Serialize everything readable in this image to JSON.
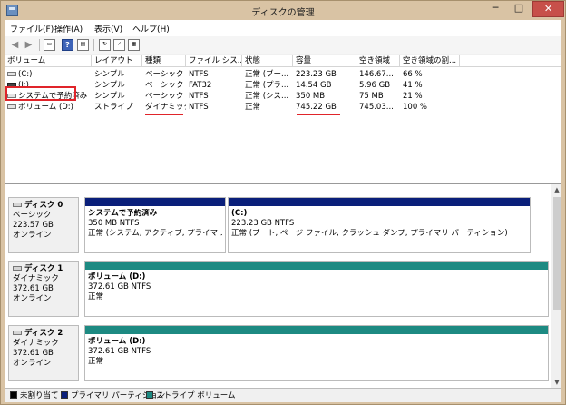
{
  "window": {
    "title": "ディスクの管理",
    "min_glyph": "─",
    "max_glyph": "□",
    "close_glyph": "✕"
  },
  "menu": [
    "ファイル(F)",
    "操作(A)",
    "表示(V)",
    "ヘルプ(H)"
  ],
  "toolbar": {
    "back_glyph": "◀",
    "forward_glyph": "▶",
    "help_glyph": "?"
  },
  "volume_list": {
    "columns": [
      "ボリューム",
      "レイアウト",
      "種類",
      "ファイル シス...",
      "状態",
      "容量",
      "空き領域",
      "空き領域の割..."
    ],
    "rows": [
      [
        "(C:)",
        "シンプル",
        "ベーシック",
        "NTFS",
        "正常 (ブー...",
        "223.23 GB",
        "146.67...",
        "66 %"
      ],
      [
        "(I:)",
        "シンプル",
        "ベーシック",
        "FAT32",
        "正常 (プラ...",
        "14.54 GB",
        "5.96 GB",
        "41 %"
      ],
      [
        "システムで予約済み",
        "シンプル",
        "ベーシック",
        "NTFS",
        "正常 (シス...",
        "350 MB",
        "75 MB",
        "21 %"
      ],
      [
        "ボリューム (D:)",
        "ストライプ",
        "ダイナミック",
        "NTFS",
        "正常",
        "745.22 GB",
        "745.03...",
        "100 %"
      ]
    ]
  },
  "disks": [
    {
      "name": "ディスク 0",
      "type": "ベーシック",
      "size": "223.57 GB",
      "status": "オンライン",
      "partitions": [
        {
          "title": "システムで予約済み",
          "size": "350 MB NTFS",
          "status": "正常 (システム, アクティブ, プライマリ パーティ"
        },
        {
          "title": "(C:)",
          "size": "223.23 GB NTFS",
          "status": "正常 (ブート, ページ ファイル, クラッシュ ダンプ, プライマリ パーティション)"
        }
      ]
    },
    {
      "name": "ディスク 1",
      "type": "ダイナミック",
      "size": "372.61 GB",
      "status": "オンライン",
      "partitions": [
        {
          "title": "ボリューム (D:)",
          "size": "372.61 GB NTFS",
          "status": "正常"
        }
      ]
    },
    {
      "name": "ディスク 2",
      "type": "ダイナミック",
      "size": "372.61 GB",
      "status": "オンライン",
      "partitions": [
        {
          "title": "ボリューム (D:)",
          "size": "372.61 GB NTFS",
          "status": "正常"
        }
      ]
    }
  ],
  "legend": [
    {
      "label": "未割り当て",
      "color": "#000000"
    },
    {
      "label": "プライマリ パーティション",
      "color": "#0a1f7a"
    },
    {
      "label": "ストライプ ボリューム",
      "color": "#1d8a82"
    }
  ],
  "colors": {
    "highlight": "#e0242a",
    "basic_bar": "#0a1f7a",
    "striped_bar": "#1d8a82"
  }
}
